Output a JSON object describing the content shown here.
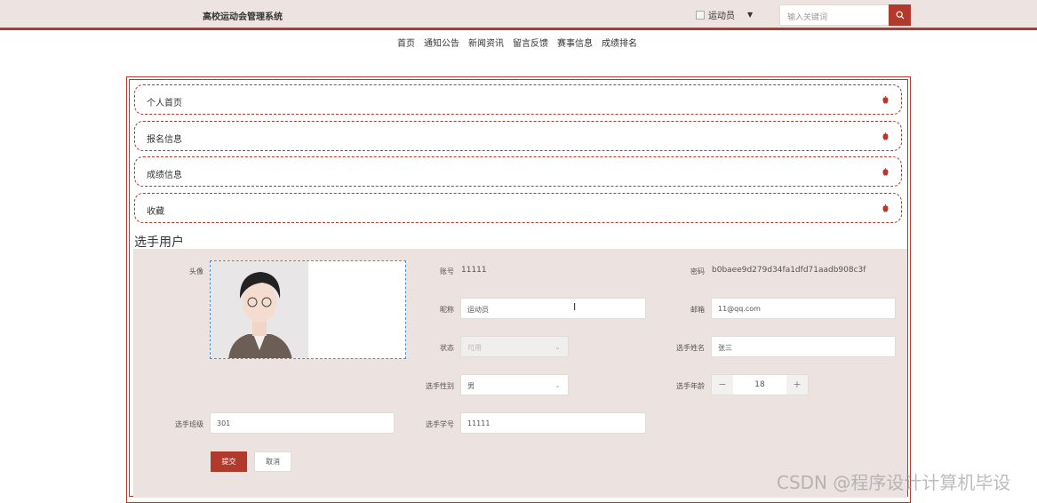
{
  "header": {
    "site_title": "高校运动会管理系统",
    "user_role": "运动员",
    "search_placeholder": "输入关键词"
  },
  "nav": [
    "首页",
    "通知公告",
    "新闻资讯",
    "留言反馈",
    "赛事信息",
    "成绩排名"
  ],
  "menu": [
    "个人首页",
    "报名信息",
    "成绩信息",
    "收藏"
  ],
  "section_title": "选手用户",
  "form": {
    "avatar_label": "头像",
    "account_label": "账号",
    "account_value": "11111",
    "password_label": "密码",
    "password_value": "b0baee9d279d34fa1dfd71aadb908c3f",
    "nickname_label": "昵称",
    "nickname_value": "运动员",
    "email_label": "邮箱",
    "email_value": "11@qq.com",
    "status_label": "状态",
    "status_value": "可用",
    "name_label": "选手姓名",
    "name_value": "张三",
    "gender_label": "选手性别",
    "gender_value": "男",
    "age_label": "选手年龄",
    "age_value": "18",
    "class_label": "选手班级",
    "class_value": "301",
    "student_no_label": "选手学号",
    "student_no_value": "11111",
    "submit_label": "提交",
    "cancel_label": "取消"
  },
  "watermark": "CSDN @程序设计计算机毕设",
  "colors": {
    "accent": "#b23a2d",
    "panel": "#ece2e0",
    "topbar": "#ede3e1"
  }
}
